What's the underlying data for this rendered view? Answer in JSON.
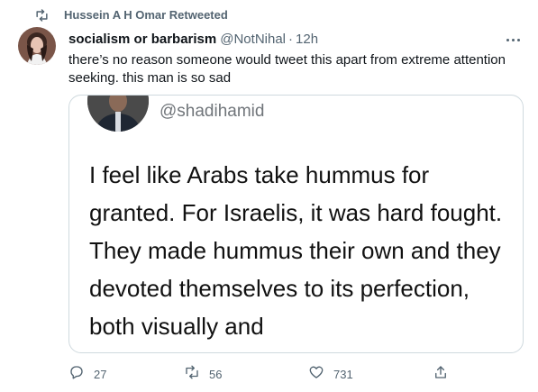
{
  "retweet": {
    "label": "Hussein A H Omar Retweeted",
    "icon": "retweet-icon"
  },
  "tweet": {
    "author_name": "socialism or barbarism",
    "author_handle": "@NotNihal",
    "separator": "·",
    "time": "12h",
    "text": "there’s no reason someone would tweet this apart from extreme attention seeking. this man is so sad",
    "more_icon": "more-options-icon"
  },
  "media": {
    "handle": "@shadihamid",
    "quote": "I feel like Arabs take hummus for granted. For Israelis, it was hard fought. They made hummus their own and they devoted themselves to its perfection, both visually and"
  },
  "actions": {
    "reply": {
      "icon": "reply-icon",
      "count": "27"
    },
    "retweet": {
      "icon": "retweet-icon",
      "count": "56"
    },
    "like": {
      "icon": "heart-icon",
      "count": "731"
    },
    "share": {
      "icon": "share-icon"
    }
  },
  "colors": {
    "secondary_text": "#536471",
    "primary_text": "#0f1419",
    "border": "#cfd9de"
  }
}
